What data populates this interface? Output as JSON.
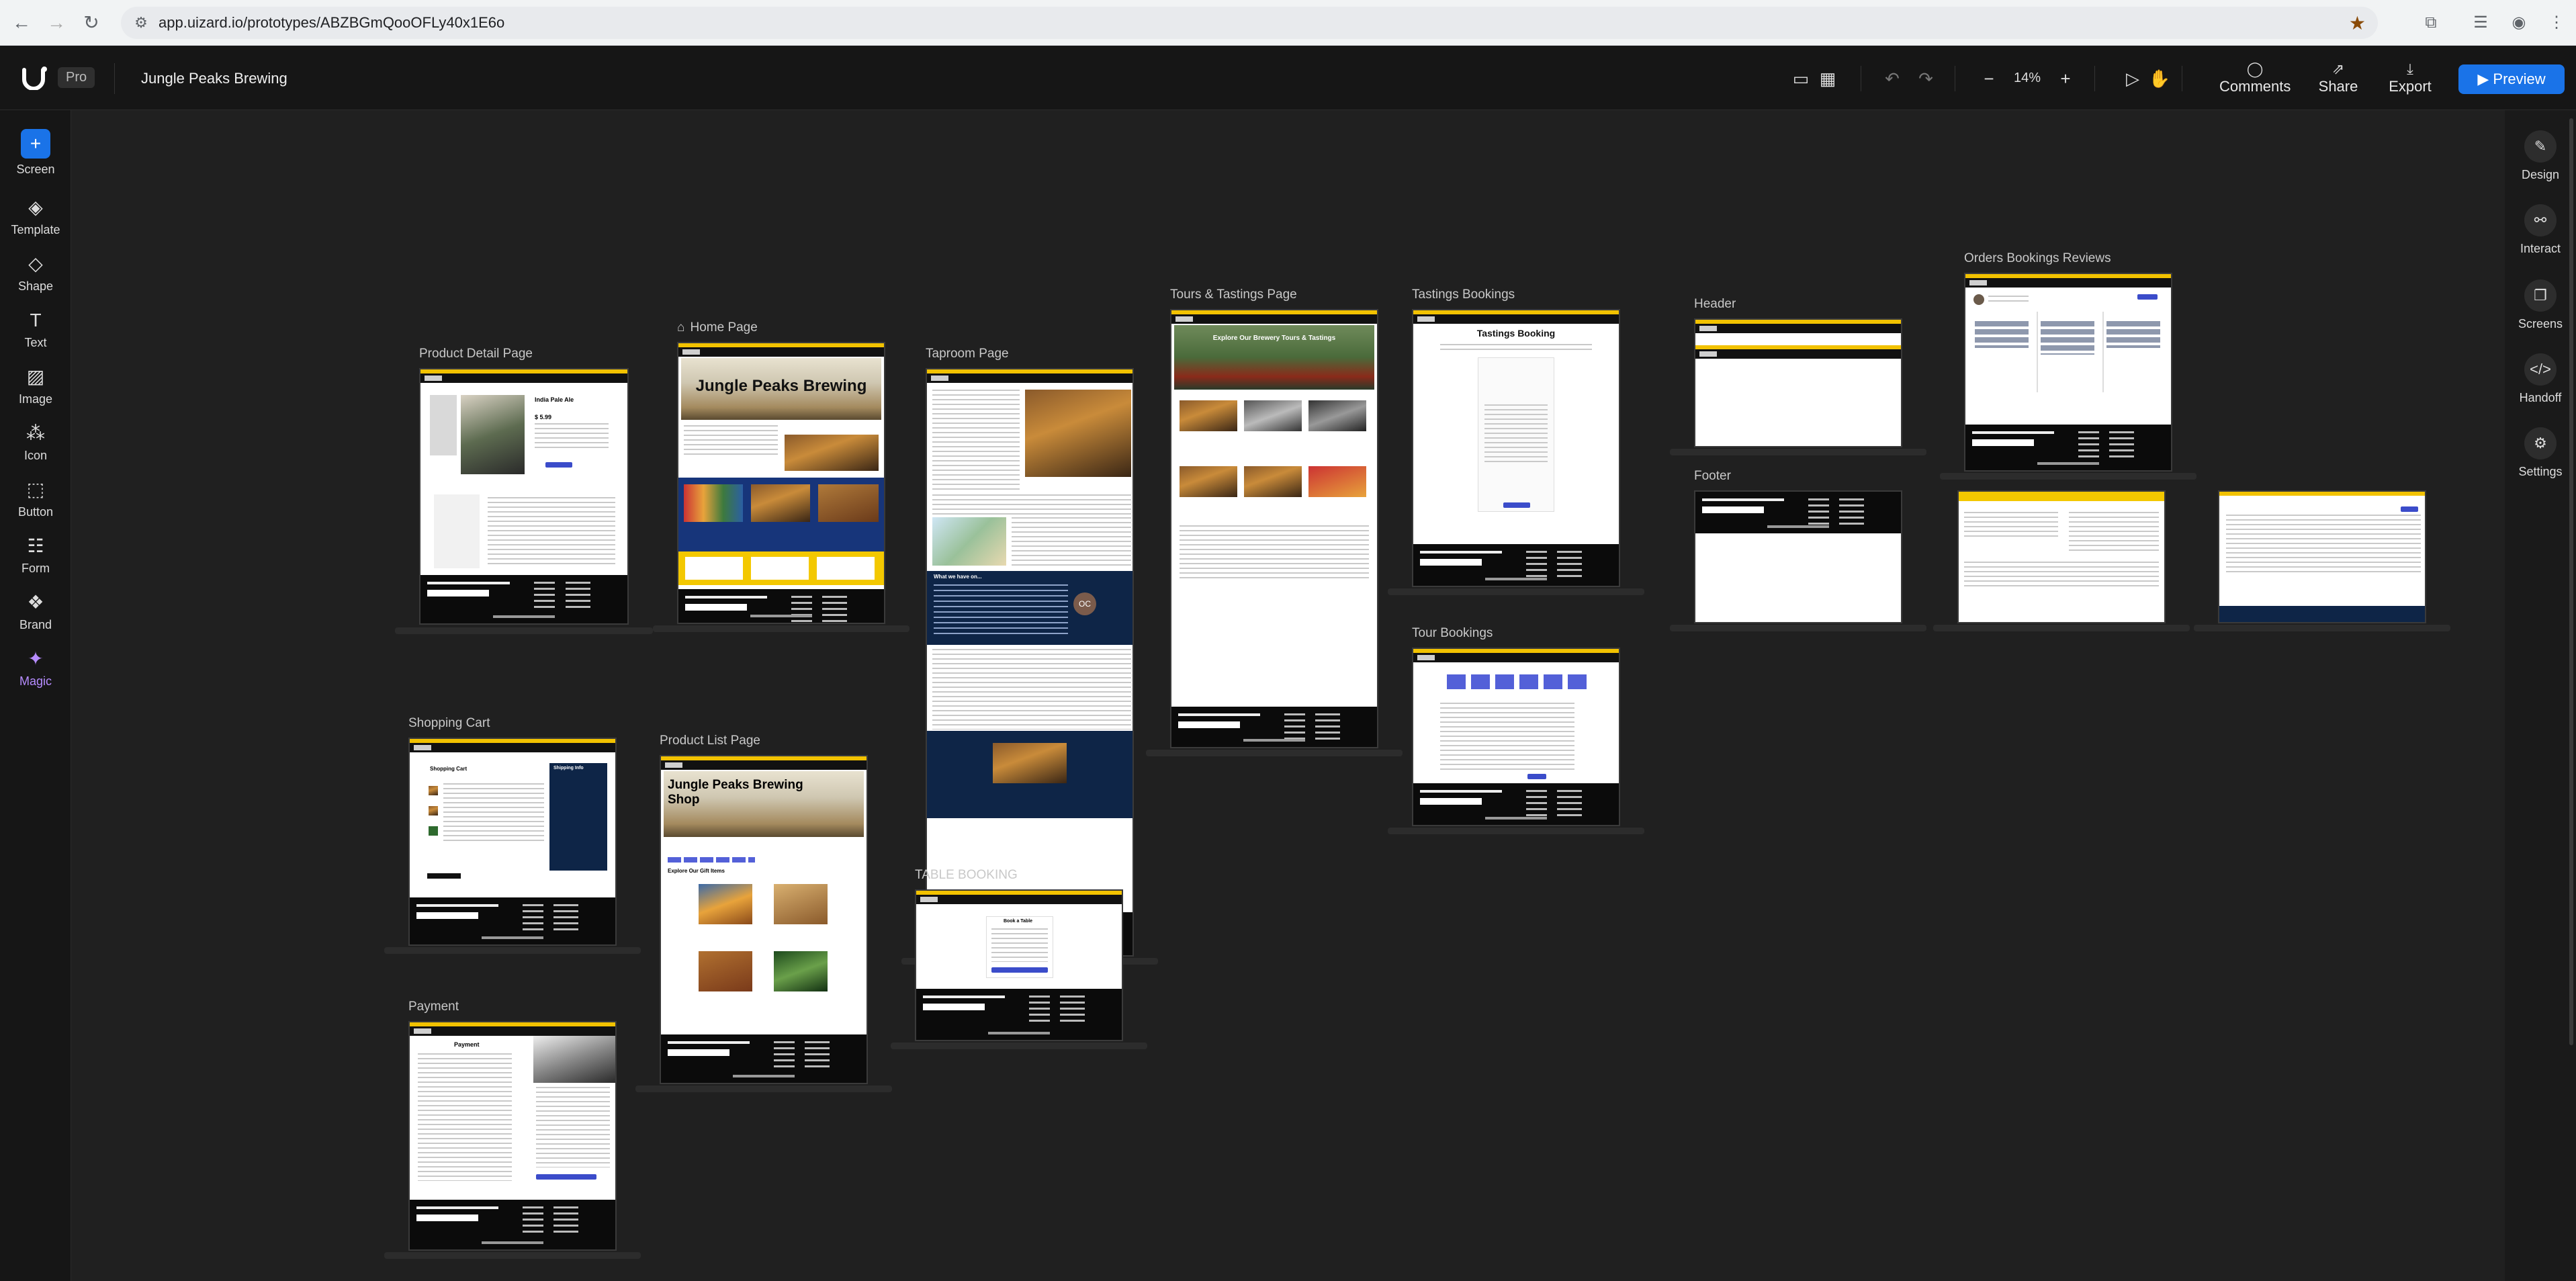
{
  "browser": {
    "url": "app.uizard.io/prototypes/ABZBGmQooOFLy40x1E6o"
  },
  "app": {
    "plan_badge": "Pro",
    "project_title": "Jungle Peaks Brewing",
    "zoom": "14%",
    "actions": {
      "comments": "Comments",
      "share": "Share",
      "export": "Export",
      "preview": "Preview"
    }
  },
  "left_tools": [
    {
      "label": "Screen"
    },
    {
      "label": "Template"
    },
    {
      "label": "Shape"
    },
    {
      "label": "Text"
    },
    {
      "label": "Image"
    },
    {
      "label": "Icon"
    },
    {
      "label": "Button"
    },
    {
      "label": "Form"
    },
    {
      "label": "Brand"
    },
    {
      "label": "Magic"
    }
  ],
  "right_tools": [
    {
      "label": "Design"
    },
    {
      "label": "Interact"
    },
    {
      "label": "Screens"
    },
    {
      "label": "Handoff"
    },
    {
      "label": "Settings"
    }
  ],
  "screens": {
    "product_detail": {
      "label": "Product Detail Page",
      "heading": "India Pale Ale",
      "price": "$ 5.99"
    },
    "home": {
      "label": "Home Page",
      "hero": "Jungle Peaks Brewing"
    },
    "taproom": {
      "label": "Taproom Page",
      "banner": "What we have on...",
      "bubble": "OC"
    },
    "tours": {
      "label": "Tours & Tastings Page",
      "hero": "Explore Our Brewery Tours & Tastings"
    },
    "tastings_bookings": {
      "label": "Tastings Bookings",
      "heading": "Tastings Booking"
    },
    "header": {
      "label": "Header"
    },
    "footer": {
      "label": "Footer"
    },
    "orders": {
      "label": "Orders Bookings Reviews"
    },
    "shopping_cart": {
      "label": "Shopping Cart",
      "heading": "Shopping Cart",
      "side_heading": "Shipping Info"
    },
    "product_list": {
      "label": "Product List Page",
      "hero": "Jungle Peaks Brewing Shop",
      "sub": "Explore Our Gift Items"
    },
    "table_booking": {
      "label": "TABLE BOOKING",
      "heading": "Book a Table"
    },
    "tour_bookings": {
      "label": "Tour Bookings"
    },
    "payment": {
      "label": "Payment",
      "heading": "Payment"
    }
  }
}
